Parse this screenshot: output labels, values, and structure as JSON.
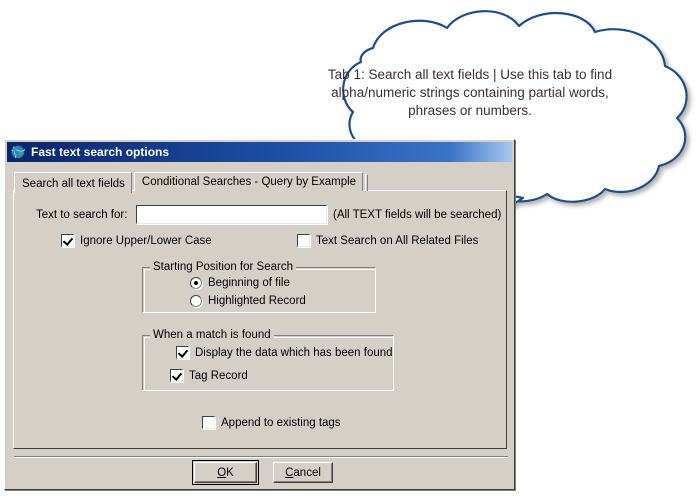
{
  "callout": {
    "text": "Tab 1: Search all text fields | Use this tab to find alpha/numeric strings containing partial words, phrases or numbers.",
    "outline_color": "#1f4e8c",
    "fill_color": "#ffffff",
    "text_color": "#3b2f3a",
    "shape": "thought-cloud"
  },
  "dialog": {
    "title": "Fast text search options",
    "icon": "globe-icon",
    "titlebar_color": "#0a246a",
    "face_color": "#d4d0c8",
    "tabs": [
      {
        "label": "Search all text fields",
        "active": true
      },
      {
        "label": "Conditional Searches - Query by Example",
        "active": false
      }
    ],
    "search": {
      "label": "Text to search for:",
      "value": "",
      "placeholder": "",
      "hint": "(All TEXT fields will be searched)"
    },
    "options": [
      {
        "label": "Ignore Upper/Lower Case",
        "checked": true
      },
      {
        "label": "Text Search on All Related Files",
        "checked": false
      }
    ],
    "starting_position": {
      "legend": "Starting Position for Search",
      "choices": [
        {
          "label": "Beginning of file",
          "selected": true
        },
        {
          "label": "Highlighted Record",
          "selected": false
        }
      ]
    },
    "on_match": {
      "legend": "When a match is found",
      "choices": [
        {
          "label": "Display the data which has been found",
          "checked": true
        },
        {
          "label": "Tag Record",
          "checked": true
        }
      ]
    },
    "append_tags": {
      "label": "Append to existing tags",
      "checked": false
    },
    "buttons": [
      {
        "label": "OK",
        "accel": "O",
        "rest": "K",
        "pre": "",
        "default": true
      },
      {
        "label": "Cancel",
        "accel": "C",
        "rest": "ancel",
        "pre": "",
        "default": false
      }
    ]
  }
}
